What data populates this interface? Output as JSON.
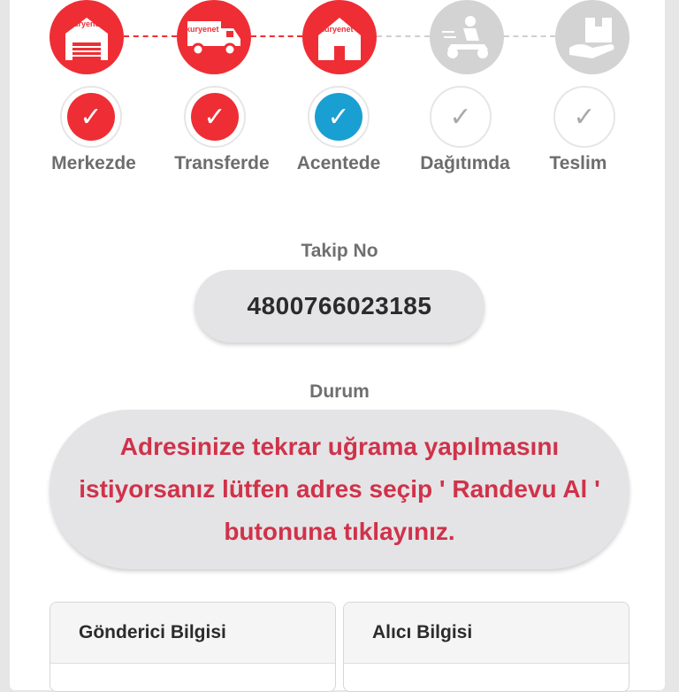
{
  "steps": [
    {
      "label": "Merkezde",
      "icon": "warehouse-icon",
      "state": "done"
    },
    {
      "label": "Transferde",
      "icon": "truck-icon",
      "state": "done"
    },
    {
      "label": "Acentede",
      "icon": "house-icon",
      "state": "current"
    },
    {
      "label": "Dağıtımda",
      "icon": "courier-scooter-icon",
      "state": "pending"
    },
    {
      "label": "Teslim",
      "icon": "package-hand-icon",
      "state": "pending"
    }
  ],
  "brand": "kuryenet",
  "check_glyph": "✓",
  "tracking": {
    "label": "Takip No",
    "number": "4800766023185"
  },
  "status": {
    "label": "Durum",
    "message": "Adresinize tekrar uğrama yapılmasını istiyorsanız lütfen adres seçip ' Randevu Al ' butonuna tıklayınız."
  },
  "sender": {
    "title": "Gönderici Bilgisi"
  },
  "receiver": {
    "title": "Alıcı Bilgisi"
  },
  "colors": {
    "accent": "#ee2e34",
    "current": "#1a9fd2",
    "status_text": "#d0324a",
    "inactive": "#d3d3d3"
  }
}
